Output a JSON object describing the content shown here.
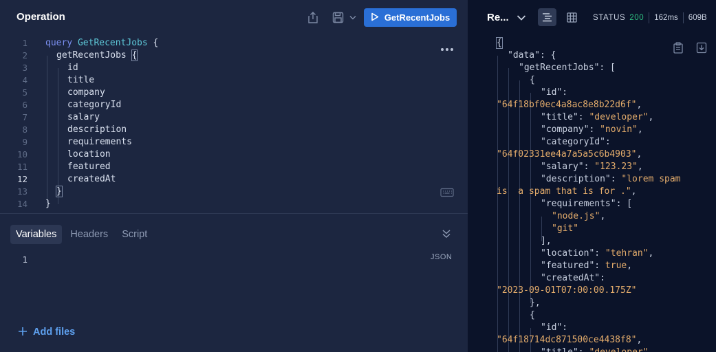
{
  "operation": {
    "title": "Operation",
    "run_label": "GetRecentJobs",
    "lines": [
      {
        "no": "1",
        "parts": [
          [
            "kw",
            "query "
          ],
          [
            "opname",
            "GetRecentJobs"
          ],
          [
            "fld",
            " {"
          ]
        ]
      },
      {
        "no": "2",
        "parts": [
          [
            "fld",
            "getRecentJobs "
          ],
          [
            "fld",
            "{"
          ]
        ]
      },
      {
        "no": "3",
        "parts": [
          [
            "fld",
            "id"
          ]
        ]
      },
      {
        "no": "4",
        "parts": [
          [
            "fld",
            "title"
          ]
        ]
      },
      {
        "no": "5",
        "parts": [
          [
            "fld",
            "company"
          ]
        ]
      },
      {
        "no": "6",
        "parts": [
          [
            "fld",
            "categoryId"
          ]
        ]
      },
      {
        "no": "7",
        "parts": [
          [
            "fld",
            "salary"
          ]
        ]
      },
      {
        "no": "8",
        "parts": [
          [
            "fld",
            "description"
          ]
        ]
      },
      {
        "no": "9",
        "parts": [
          [
            "fld",
            "requirements"
          ]
        ]
      },
      {
        "no": "10",
        "parts": [
          [
            "fld",
            "location"
          ]
        ]
      },
      {
        "no": "11",
        "parts": [
          [
            "fld",
            "featured"
          ]
        ]
      },
      {
        "no": "12",
        "parts": [
          [
            "fld",
            "createdAt"
          ]
        ]
      },
      {
        "no": "13",
        "parts": [
          [
            "fld",
            "}"
          ]
        ]
      },
      {
        "no": "14",
        "parts": [
          [
            "fld",
            "}"
          ]
        ]
      }
    ]
  },
  "tabs": [
    "Variables",
    "Headers",
    "Script"
  ],
  "variables": {
    "line_no": "1",
    "format_label": "JSON"
  },
  "add_files_label": "Add files",
  "response": {
    "title": "Re...",
    "status_label": "STATUS",
    "status_code": "200",
    "time": "162ms",
    "size": "609B",
    "lines": [
      [
        [
          "jk",
          "{"
        ]
      ],
      [
        [
          "jk",
          "\"data\": {"
        ]
      ],
      [
        [
          "jk",
          "\"getRecentJobs\": ["
        ]
      ],
      [
        [
          "jk",
          "{"
        ]
      ],
      [
        [
          "jk",
          "\"id\":"
        ]
      ],
      [
        [
          "js",
          "\"64f18bf0ec4a8ac8e8b22d6f\""
        ],
        [
          "jk",
          ","
        ]
      ],
      [
        [
          "jk",
          "\"title\": "
        ],
        [
          "js",
          "\"developer\""
        ],
        [
          "jk",
          ","
        ]
      ],
      [
        [
          "jk",
          "\"company\": "
        ],
        [
          "js",
          "\"novin\""
        ],
        [
          "jk",
          ","
        ]
      ],
      [
        [
          "jk",
          "\"categoryId\":"
        ]
      ],
      [
        [
          "js",
          "\"64f02331ee4a7a5a5c6b4903\""
        ],
        [
          "jk",
          ","
        ]
      ],
      [
        [
          "jk",
          "\"salary\": "
        ],
        [
          "js",
          "\"123.23\""
        ],
        [
          "jk",
          ","
        ]
      ],
      [
        [
          "jk",
          "\"description\": "
        ],
        [
          "js",
          "\"lorem spam"
        ]
      ],
      [
        [
          "js",
          "is  a spam that is for .\""
        ],
        [
          "jk",
          ","
        ]
      ],
      [
        [
          "jk",
          "\"requirements\": ["
        ]
      ],
      [
        [
          "js",
          "\"node.js\""
        ],
        [
          "jk",
          ","
        ]
      ],
      [
        [
          "js",
          "\"git\""
        ]
      ],
      [
        [
          "jk",
          "],"
        ]
      ],
      [
        [
          "jk",
          "\"location\": "
        ],
        [
          "js",
          "\"tehran\""
        ],
        [
          "jk",
          ","
        ]
      ],
      [
        [
          "jk",
          "\"featured\": "
        ],
        [
          "jb",
          "true"
        ],
        [
          "jk",
          ","
        ]
      ],
      [
        [
          "jk",
          "\"createdAt\":"
        ]
      ],
      [
        [
          "js",
          "\"2023-09-01T07:00:00.175Z\""
        ]
      ],
      [
        [
          "jk",
          "},"
        ]
      ],
      [
        [
          "jk",
          "{"
        ]
      ],
      [
        [
          "jk",
          "\"id\":"
        ]
      ],
      [
        [
          "js",
          "\"64f18714dc871500ce4438f8\""
        ],
        [
          "jk",
          ","
        ]
      ],
      [
        [
          "jk",
          "\"title\": "
        ],
        [
          "js",
          "\"developer\""
        ]
      ]
    ]
  },
  "colors": {
    "accent": "#2a6fd6",
    "status_ok": "#2fbf80",
    "string": "#e5ad6c",
    "keyword": "#7a8ff0",
    "operation_name": "#5ec8d8"
  },
  "icons": [
    "share-icon",
    "save-icon",
    "chevron-down-icon",
    "play-icon",
    "more-icon",
    "keyboard-icon",
    "collapse-icon",
    "plus-icon",
    "list-view-icon",
    "table-view-icon",
    "copy-icon",
    "download-icon"
  ]
}
